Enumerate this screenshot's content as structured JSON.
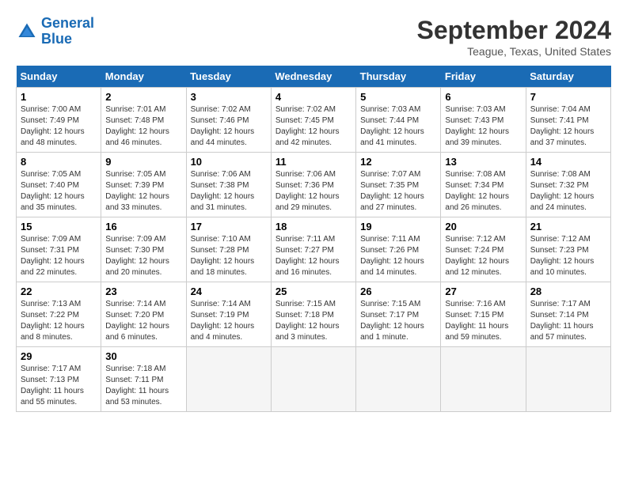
{
  "logo": {
    "line1": "General",
    "line2": "Blue"
  },
  "title": "September 2024",
  "subtitle": "Teague, Texas, United States",
  "days_of_week": [
    "Sunday",
    "Monday",
    "Tuesday",
    "Wednesday",
    "Thursday",
    "Friday",
    "Saturday"
  ],
  "weeks": [
    [
      {
        "day": 1,
        "info": "Sunrise: 7:00 AM\nSunset: 7:49 PM\nDaylight: 12 hours\nand 48 minutes."
      },
      {
        "day": 2,
        "info": "Sunrise: 7:01 AM\nSunset: 7:48 PM\nDaylight: 12 hours\nand 46 minutes."
      },
      {
        "day": 3,
        "info": "Sunrise: 7:02 AM\nSunset: 7:46 PM\nDaylight: 12 hours\nand 44 minutes."
      },
      {
        "day": 4,
        "info": "Sunrise: 7:02 AM\nSunset: 7:45 PM\nDaylight: 12 hours\nand 42 minutes."
      },
      {
        "day": 5,
        "info": "Sunrise: 7:03 AM\nSunset: 7:44 PM\nDaylight: 12 hours\nand 41 minutes."
      },
      {
        "day": 6,
        "info": "Sunrise: 7:03 AM\nSunset: 7:43 PM\nDaylight: 12 hours\nand 39 minutes."
      },
      {
        "day": 7,
        "info": "Sunrise: 7:04 AM\nSunset: 7:41 PM\nDaylight: 12 hours\nand 37 minutes."
      }
    ],
    [
      {
        "day": 8,
        "info": "Sunrise: 7:05 AM\nSunset: 7:40 PM\nDaylight: 12 hours\nand 35 minutes."
      },
      {
        "day": 9,
        "info": "Sunrise: 7:05 AM\nSunset: 7:39 PM\nDaylight: 12 hours\nand 33 minutes."
      },
      {
        "day": 10,
        "info": "Sunrise: 7:06 AM\nSunset: 7:38 PM\nDaylight: 12 hours\nand 31 minutes."
      },
      {
        "day": 11,
        "info": "Sunrise: 7:06 AM\nSunset: 7:36 PM\nDaylight: 12 hours\nand 29 minutes."
      },
      {
        "day": 12,
        "info": "Sunrise: 7:07 AM\nSunset: 7:35 PM\nDaylight: 12 hours\nand 27 minutes."
      },
      {
        "day": 13,
        "info": "Sunrise: 7:08 AM\nSunset: 7:34 PM\nDaylight: 12 hours\nand 26 minutes."
      },
      {
        "day": 14,
        "info": "Sunrise: 7:08 AM\nSunset: 7:32 PM\nDaylight: 12 hours\nand 24 minutes."
      }
    ],
    [
      {
        "day": 15,
        "info": "Sunrise: 7:09 AM\nSunset: 7:31 PM\nDaylight: 12 hours\nand 22 minutes."
      },
      {
        "day": 16,
        "info": "Sunrise: 7:09 AM\nSunset: 7:30 PM\nDaylight: 12 hours\nand 20 minutes."
      },
      {
        "day": 17,
        "info": "Sunrise: 7:10 AM\nSunset: 7:28 PM\nDaylight: 12 hours\nand 18 minutes."
      },
      {
        "day": 18,
        "info": "Sunrise: 7:11 AM\nSunset: 7:27 PM\nDaylight: 12 hours\nand 16 minutes."
      },
      {
        "day": 19,
        "info": "Sunrise: 7:11 AM\nSunset: 7:26 PM\nDaylight: 12 hours\nand 14 minutes."
      },
      {
        "day": 20,
        "info": "Sunrise: 7:12 AM\nSunset: 7:24 PM\nDaylight: 12 hours\nand 12 minutes."
      },
      {
        "day": 21,
        "info": "Sunrise: 7:12 AM\nSunset: 7:23 PM\nDaylight: 12 hours\nand 10 minutes."
      }
    ],
    [
      {
        "day": 22,
        "info": "Sunrise: 7:13 AM\nSunset: 7:22 PM\nDaylight: 12 hours\nand 8 minutes."
      },
      {
        "day": 23,
        "info": "Sunrise: 7:14 AM\nSunset: 7:20 PM\nDaylight: 12 hours\nand 6 minutes."
      },
      {
        "day": 24,
        "info": "Sunrise: 7:14 AM\nSunset: 7:19 PM\nDaylight: 12 hours\nand 4 minutes."
      },
      {
        "day": 25,
        "info": "Sunrise: 7:15 AM\nSunset: 7:18 PM\nDaylight: 12 hours\nand 3 minutes."
      },
      {
        "day": 26,
        "info": "Sunrise: 7:15 AM\nSunset: 7:17 PM\nDaylight: 12 hours\nand 1 minute."
      },
      {
        "day": 27,
        "info": "Sunrise: 7:16 AM\nSunset: 7:15 PM\nDaylight: 11 hours\nand 59 minutes."
      },
      {
        "day": 28,
        "info": "Sunrise: 7:17 AM\nSunset: 7:14 PM\nDaylight: 11 hours\nand 57 minutes."
      }
    ],
    [
      {
        "day": 29,
        "info": "Sunrise: 7:17 AM\nSunset: 7:13 PM\nDaylight: 11 hours\nand 55 minutes."
      },
      {
        "day": 30,
        "info": "Sunrise: 7:18 AM\nSunset: 7:11 PM\nDaylight: 11 hours\nand 53 minutes."
      },
      null,
      null,
      null,
      null,
      null
    ]
  ]
}
